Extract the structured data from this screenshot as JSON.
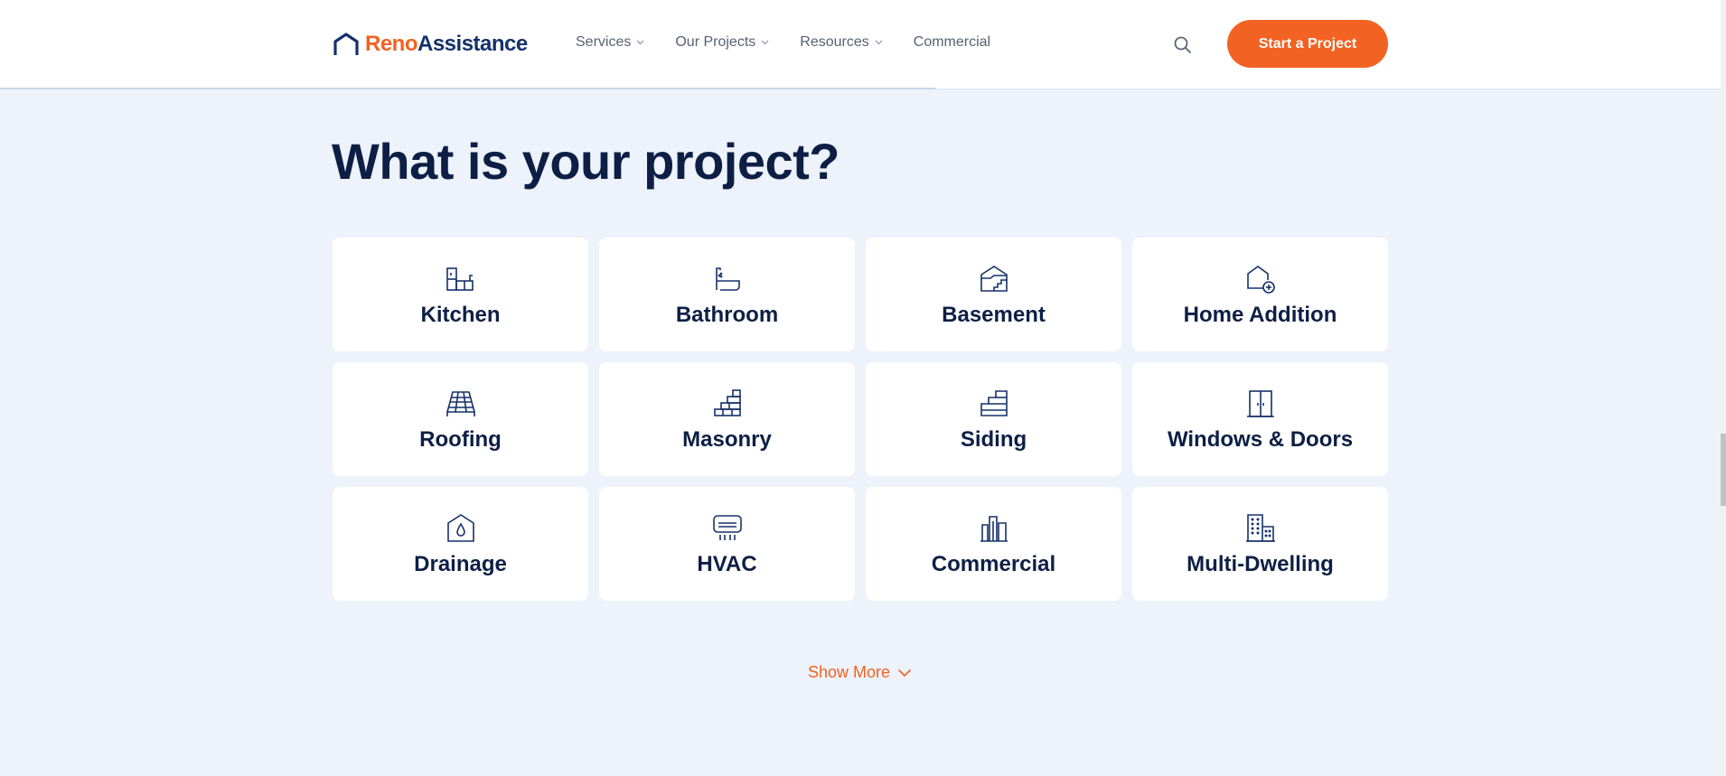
{
  "header": {
    "logo": {
      "part1": "Reno",
      "part2": "Assistance"
    },
    "nav": [
      {
        "label": "Services",
        "has_dropdown": true
      },
      {
        "label": "Our Projects",
        "has_dropdown": true
      },
      {
        "label": "Resources",
        "has_dropdown": true
      },
      {
        "label": "Commercial",
        "has_dropdown": false
      }
    ],
    "search_icon": "search-icon",
    "cta_label": "Start a Project"
  },
  "main": {
    "title": "What is your project?",
    "projects": [
      {
        "label": "Kitchen",
        "icon": "kitchen-icon"
      },
      {
        "label": "Bathroom",
        "icon": "bathtub-icon"
      },
      {
        "label": "Basement",
        "icon": "basement-icon"
      },
      {
        "label": "Home Addition",
        "icon": "home-addition-icon"
      },
      {
        "label": "Roofing",
        "icon": "roofing-icon"
      },
      {
        "label": "Masonry",
        "icon": "bricks-icon"
      },
      {
        "label": "Siding",
        "icon": "siding-icon"
      },
      {
        "label": "Windows & Doors",
        "icon": "door-icon"
      },
      {
        "label": "Drainage",
        "icon": "drainage-icon"
      },
      {
        "label": "HVAC",
        "icon": "air-conditioner-icon"
      },
      {
        "label": "Commercial",
        "icon": "commercial-building-icon"
      },
      {
        "label": "Multi-Dwelling",
        "icon": "apartment-building-icon"
      }
    ],
    "show_more_label": "Show More"
  },
  "colors": {
    "accent": "#f26222",
    "navy": "#0d1f45",
    "background": "#eef2fb"
  }
}
